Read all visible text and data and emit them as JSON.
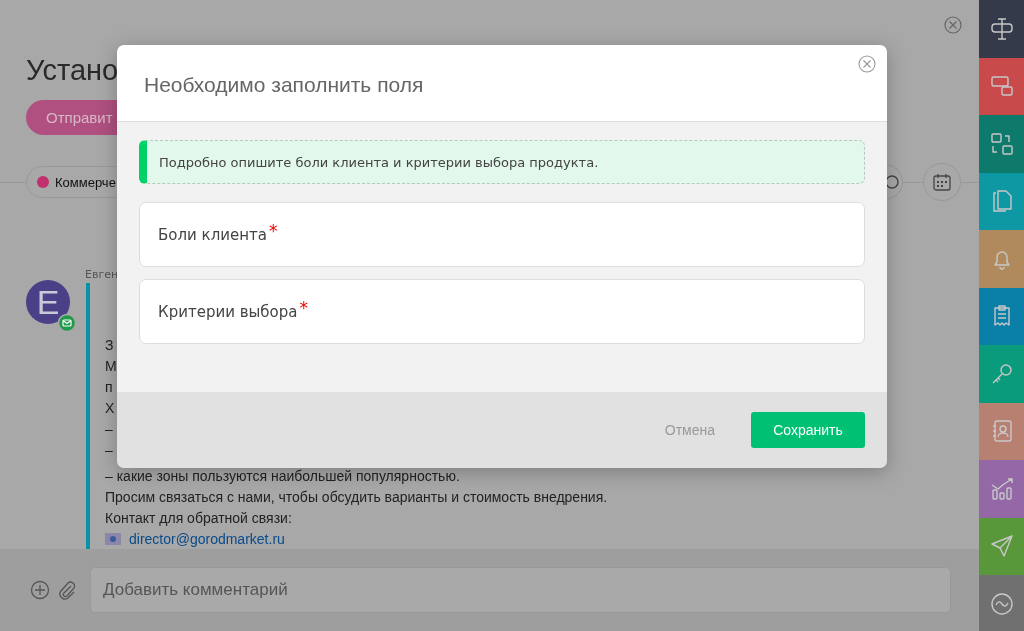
{
  "page": {
    "title": "Устано",
    "send_button": "Отправит",
    "stage": {
      "label": "Коммерче",
      "color": "#c0306e"
    },
    "author": "Евген",
    "avatar_letter": "E",
    "message_lines": [
      "З",
      "М",
      "п",
      "Х",
      "–",
      "–",
      "– какие зоны пользуются наибольшей популярностью.",
      "Просим связаться с нами, чтобы обсудить варианты и стоимость внедрения.",
      "Контакт для обратной связи:"
    ],
    "email": "director@gorodmarket.ru"
  },
  "comment": {
    "placeholder": "Добавить комментарий"
  },
  "sidebar": {
    "items": [
      {
        "kind": "signpost",
        "color": "#343a4a"
      },
      {
        "kind": "boxes",
        "color": "#c84a4a"
      },
      {
        "kind": "swap",
        "color": "#0e7a6c"
      },
      {
        "kind": "documents",
        "color": "#0e98a4"
      },
      {
        "kind": "bell",
        "color": "#b08a5c"
      },
      {
        "kind": "clipboard",
        "color": "#0a80a8"
      },
      {
        "kind": "key",
        "color": "#0a9a7c"
      },
      {
        "kind": "contact",
        "color": "#b88070"
      },
      {
        "kind": "chart",
        "color": "#9468a6"
      },
      {
        "kind": "plane",
        "color": "#58983a"
      },
      {
        "kind": "wave",
        "color": "#707070"
      }
    ]
  },
  "dialog": {
    "title": "Необходимо заполнить поля",
    "hint": "Подробно опишите боли клиента и критерии выбора продукта.",
    "fields": [
      {
        "label": "Боли клиента",
        "mark": "*"
      },
      {
        "label": "Критерии выбора",
        "mark": "*"
      }
    ],
    "cancel": "Отмена",
    "save": "Сохранить"
  }
}
